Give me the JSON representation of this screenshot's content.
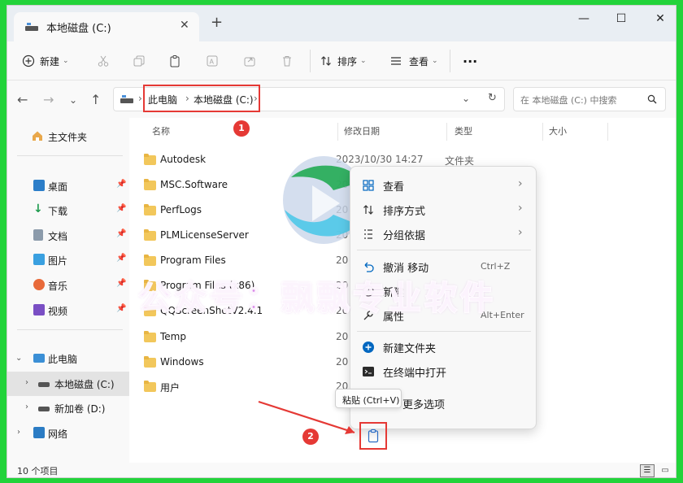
{
  "tab": {
    "title": "本地磁盘 (C:)",
    "close": "✕",
    "add": "+"
  },
  "window_controls": {
    "minimize": "—",
    "maximize": "☐",
    "close": "✕"
  },
  "command_bar": {
    "new_label": "新建",
    "sort_label": "排序",
    "view_label": "查看",
    "more_label": "···"
  },
  "address": {
    "crumbs": [
      "此电脑",
      "本地磁盘 (C:)"
    ],
    "sep": "›",
    "search_placeholder": "在 本地磁盘 (C:) 中搜索"
  },
  "sidebar": {
    "home": "主文件夹",
    "pinned": [
      "桌面",
      "下载",
      "文档",
      "图片",
      "音乐",
      "视频"
    ],
    "this_pc": "此电脑",
    "drives": [
      "本地磁盘 (C:)",
      "新加卷 (D:)"
    ],
    "network": "网络"
  },
  "columns": [
    "名称",
    "修改日期",
    "类型",
    "大小"
  ],
  "files": [
    {
      "name": "Autodesk",
      "date": "2023/10/30 14:27",
      "type": "文件夹"
    },
    {
      "name": "MSC.Software",
      "date": "20",
      "type": ""
    },
    {
      "name": "PerfLogs",
      "date": "20",
      "type": ""
    },
    {
      "name": "PLMLicenseServer",
      "date": "20",
      "type": ""
    },
    {
      "name": "Program Files",
      "date": "20",
      "type": ""
    },
    {
      "name": "Program Files (x86)",
      "date": "20",
      "type": ""
    },
    {
      "name": "QQScreenShotV2.4.1",
      "date": "20",
      "type": ""
    },
    {
      "name": "Temp",
      "date": "20",
      "type": ""
    },
    {
      "name": "Windows",
      "date": "20",
      "type": ""
    },
    {
      "name": "用户",
      "date": "20",
      "type": ""
    }
  ],
  "context_menu": {
    "view": "查看",
    "sort": "排序方式",
    "group": "分组依据",
    "undo": "撤消 移动",
    "undo_key": "Ctrl+Z",
    "new": "新建",
    "properties": "属性",
    "properties_key": "Alt+Enter",
    "new_folder": "新建文件夹",
    "terminal": "在终端中打开",
    "more_options": "更多选项"
  },
  "tooltip": "粘贴 (Ctrl+V)",
  "badges": [
    "1",
    "2"
  ],
  "status": {
    "count": "10 个项目"
  },
  "watermark": "公众号：飘飘专业软件",
  "colors": {
    "accent": "#0067c0",
    "annotation": "#e53935",
    "folder": "#f2c75b",
    "background": "#22d33a"
  }
}
